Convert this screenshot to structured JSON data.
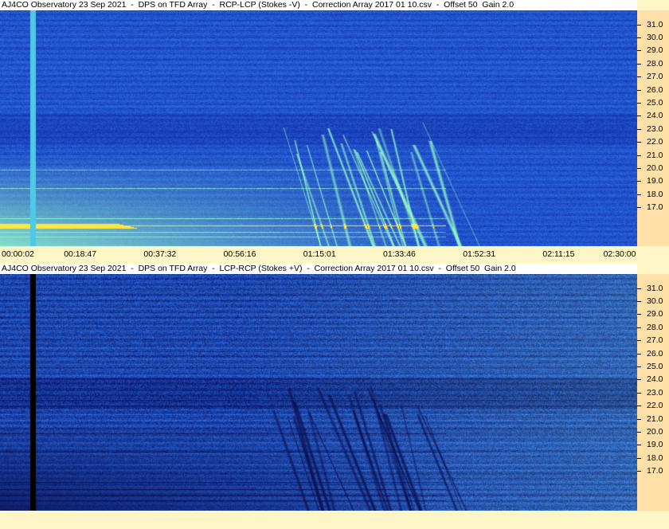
{
  "panels": [
    {
      "title": "AJ4CO Observatory 23 Sep 2021  -  DPS on TFD Array  -  RCP-LCP (Stokes -V)  -  Correction Array 2017 01 10.csv  -  Offset 50  Gain 2.0",
      "polarity": "RCP-LCP",
      "palette": {
        "base": "#2f6fe6",
        "dark": "#1437b0",
        "bright": "#8ff0c8",
        "hot": "#ffe640"
      }
    },
    {
      "title": "AJ4CO Observatory 23 Sep 2021  -  DPS on TFD Array  -  LCP-RCP (Stokes +V)  -  Correction Array 2017 01 10.csv  -  Offset 50  Gain 2.0",
      "polarity": "LCP-RCP",
      "palette": {
        "base": "#2f6fe6",
        "dark": "#0a1a70",
        "bright": "#5aa0ff",
        "hot": "#000000"
      }
    }
  ],
  "freq_labels": [
    "31.0",
    "30.0",
    "29.0",
    "28.0",
    "27.0",
    "26.0",
    "25.0",
    "24.0",
    "23.0",
    "22.0",
    "21.0",
    "20.0",
    "19.0",
    "18.0",
    "17.0"
  ],
  "time_labels": [
    "00:00:02",
    "00:18:47",
    "00:37:32",
    "00:56:16",
    "01:15:01",
    "01:33:46",
    "01:52:31",
    "02:11:15",
    "02:30:00"
  ],
  "chart_data": {
    "type": "heatmap",
    "title": "AJ4CO Observatory 23 Sep 2021 - DPS on TFD Array",
    "x_ticks": [
      "00:00:02",
      "00:18:47",
      "00:37:32",
      "00:56:16",
      "01:15:01",
      "01:33:46",
      "01:52:31",
      "02:11:15",
      "02:30:00"
    ],
    "y_ticks": [
      31.0,
      30.0,
      29.0,
      28.0,
      27.0,
      26.0,
      25.0,
      24.0,
      23.0,
      22.0,
      21.0,
      20.0,
      19.0,
      18.0,
      17.0
    ],
    "ylim": [
      16.5,
      31.7
    ],
    "panels": [
      "RCP-LCP (Stokes -V)",
      "LCP-RCP (Stokes +V)"
    ],
    "colors": {
      "background": "#2f6fe6",
      "emission": "#8ff0c8"
    }
  }
}
